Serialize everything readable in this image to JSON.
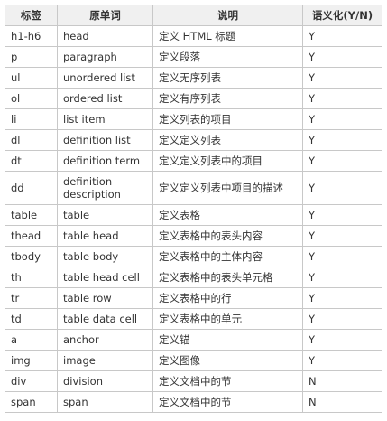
{
  "table": {
    "headers": [
      "标签",
      "原单词",
      "说明",
      "语义化(Y/N)"
    ],
    "rows": [
      [
        "h1-h6",
        "head",
        "定义 HTML 标题",
        "Y"
      ],
      [
        "p",
        "paragraph",
        "定义段落",
        "Y"
      ],
      [
        "ul",
        "unordered list",
        "定义无序列表",
        "Y"
      ],
      [
        "ol",
        "ordered list",
        "定义有序列表",
        "Y"
      ],
      [
        "li",
        "list item",
        "定义列表的项目",
        "Y"
      ],
      [
        "dl",
        "definition list",
        "定义定义列表",
        "Y"
      ],
      [
        "dt",
        "definition term",
        "定义定义列表中的项目",
        "Y"
      ],
      [
        "dd",
        "definition description",
        "定义定义列表中项目的描述",
        "Y"
      ],
      [
        "table",
        "table",
        "定义表格",
        "Y"
      ],
      [
        "thead",
        "table head",
        "定义表格中的表头内容",
        "Y"
      ],
      [
        "tbody",
        "table body",
        "定义表格中的主体内容",
        "Y"
      ],
      [
        "th",
        "table head cell",
        "定义表格中的表头单元格",
        "Y"
      ],
      [
        "tr",
        "table row",
        "定义表格中的行",
        "Y"
      ],
      [
        "td",
        "table data cell",
        "定义表格中的单元",
        "Y"
      ],
      [
        "a",
        "anchor",
        "定义锚",
        "Y"
      ],
      [
        "img",
        "image",
        "定义图像",
        "Y"
      ],
      [
        "div",
        "division",
        "定义文档中的节",
        "N"
      ],
      [
        "span",
        "span",
        "定义文档中的节",
        "N"
      ]
    ]
  }
}
